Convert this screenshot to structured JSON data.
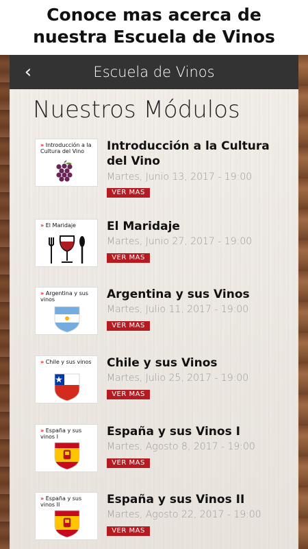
{
  "promo": {
    "line1": "Conoce mas acerca de",
    "line2": "nuestra Escuela de Vinos"
  },
  "appbar": {
    "back_icon": "‹",
    "title": "Escuela de Vinos"
  },
  "section": {
    "title": "Nuestros Módulos"
  },
  "modules": [
    {
      "thumb_mark": "»",
      "thumb_label": "Introducción a la Cultura del Vino",
      "thumb_icon": "grapes-icon",
      "title": "Introducción a la Cultura del Vino",
      "date": "Martes, Junio 13, 2017 - 19:00",
      "button": "VER MAS"
    },
    {
      "thumb_mark": "»",
      "thumb_label": "El Maridaje",
      "thumb_icon": "wine-glass-cutlery-icon",
      "title": "El Maridaje",
      "date": "Martes, Junio 27, 2017 - 19:00",
      "button": "VER MAS"
    },
    {
      "thumb_mark": "»",
      "thumb_label": "Argentina y sus vinos",
      "thumb_icon": "argentina-flag-shield-icon",
      "title": "Argentina y sus Vinos",
      "date": "Martes, Julio 11, 2017 - 19:00",
      "button": "VER MAS"
    },
    {
      "thumb_mark": "»",
      "thumb_label": "Chile y sus vinos",
      "thumb_icon": "chile-flag-shield-icon",
      "title": "Chile y sus Vinos",
      "date": "Martes, Julio 25, 2017 - 19:00",
      "button": "VER MAS"
    },
    {
      "thumb_mark": "»",
      "thumb_label": "España y sus vinos I",
      "thumb_icon": "spain-flag-shield-icon",
      "title": "España y sus Vinos I",
      "date": "Martes, Agosto 8, 2017 - 19:00",
      "button": "VER MAS"
    },
    {
      "thumb_mark": "»",
      "thumb_label": "España y sus vinos II",
      "thumb_icon": "spain-flag-shield-icon",
      "title": "España y sus Vinos II",
      "date": "Martes, Agosto 22, 2017 - 19:00",
      "button": "VER MAS"
    }
  ],
  "colors": {
    "appbar": "#333333",
    "button": "#b51c22",
    "date_text": "#9a9a9a"
  }
}
